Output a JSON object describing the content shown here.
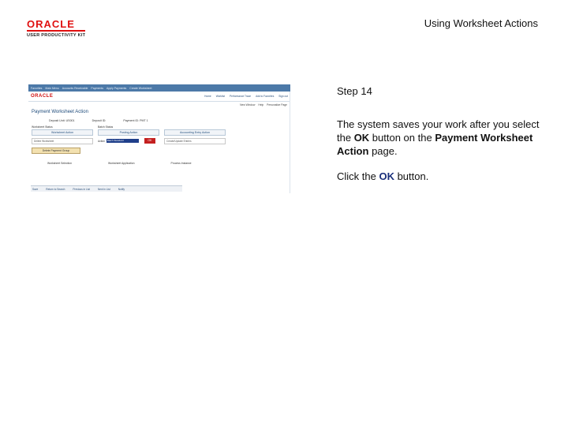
{
  "slide": {
    "title": "Using Worksheet Actions",
    "logo_brand": "ORACLE",
    "logo_sub": "USER PRODUCTIVITY KIT"
  },
  "screenshot": {
    "nav_items": [
      "Favorites",
      "Main Menu",
      "Accounts Receivable",
      "Payments",
      "Apply Payments",
      "Create Worksheet"
    ],
    "oracle_label": "ORACLE",
    "header_links": [
      "Home",
      "Worklist",
      "Performance Trace",
      "Add to Favorites",
      "Sign out"
    ],
    "subheader_links": [
      "New Window",
      "Help",
      "Personalize Page"
    ],
    "page_title": "Payment Worksheet Action",
    "info": [
      "Deposit Unit: US001",
      "Deposit ID:",
      "Payment ID: PMT 1"
    ],
    "col1_head": "Worksheet Status",
    "col1_box": "Worksheet Action",
    "col1_field": "Delete Worksheet",
    "col1_button": "Delete Payment Group",
    "col2_head": "Batch Status",
    "col2_box": "Posting Action",
    "col2_action_label": "Action",
    "col2_action_value": "Batch Standard",
    "col2_ok": "OK",
    "col3_box": "Accounting Entry Action",
    "col3_field": "Create/Update Entries",
    "lower": [
      "Worksheet Selection",
      "Worksheet Application",
      "Process Instance"
    ],
    "footer": [
      "Save",
      "Return to Search",
      "Previous in List",
      "Next in List",
      "Notify"
    ]
  },
  "instructions": {
    "step": "Step 14",
    "p1_pre": "The system saves your work after you select the ",
    "p1_ok": "OK",
    "p1_mid": " button on the ",
    "p1_page": "Payment Worksheet Action",
    "p1_post": " page.",
    "p2_pre": "Click the ",
    "p2_ok": "OK",
    "p2_post": " button."
  }
}
